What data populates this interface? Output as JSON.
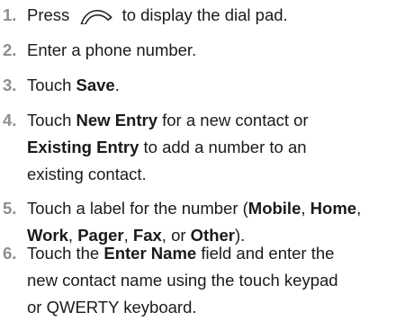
{
  "steps": [
    {
      "number": "1.",
      "before_icon": "Press",
      "icon": "send-key-icon",
      "after_icon": "to display the dial pad."
    },
    {
      "number": "2.",
      "text": "Enter a phone number."
    },
    {
      "number": "3.",
      "t1": "Touch ",
      "b1": "Save",
      "t2": "."
    },
    {
      "number": "4.",
      "line1_t1": "Touch ",
      "line1_b1": "New Entry",
      "line1_t2": " for a new contact or",
      "line2_b1": "Existing Entry",
      "line2_t1": " to add a number to an",
      "line3_t1": "existing contact."
    },
    {
      "number": "5.",
      "line1_t1": "Touch a label for the number (",
      "line1_b1": "Mobile",
      "line1_t2": ", ",
      "line1_b2": "Home",
      "line1_t3": ",",
      "line2_b1": "Work",
      "line2_t1": ", ",
      "line2_b2": "Pager",
      "line2_t2": ", ",
      "line2_b3": "Fax",
      "line2_t3": ", or ",
      "line2_b4": "Other",
      "line2_t4": ")."
    },
    {
      "number": "6.",
      "line1_t1": " Touch the ",
      "line1_b1": "Enter Name",
      "line1_t2": " field and enter the",
      "line2_t1": "new contact name using the touch keypad",
      "line3_t1": "or QWERTY keyboard."
    }
  ]
}
